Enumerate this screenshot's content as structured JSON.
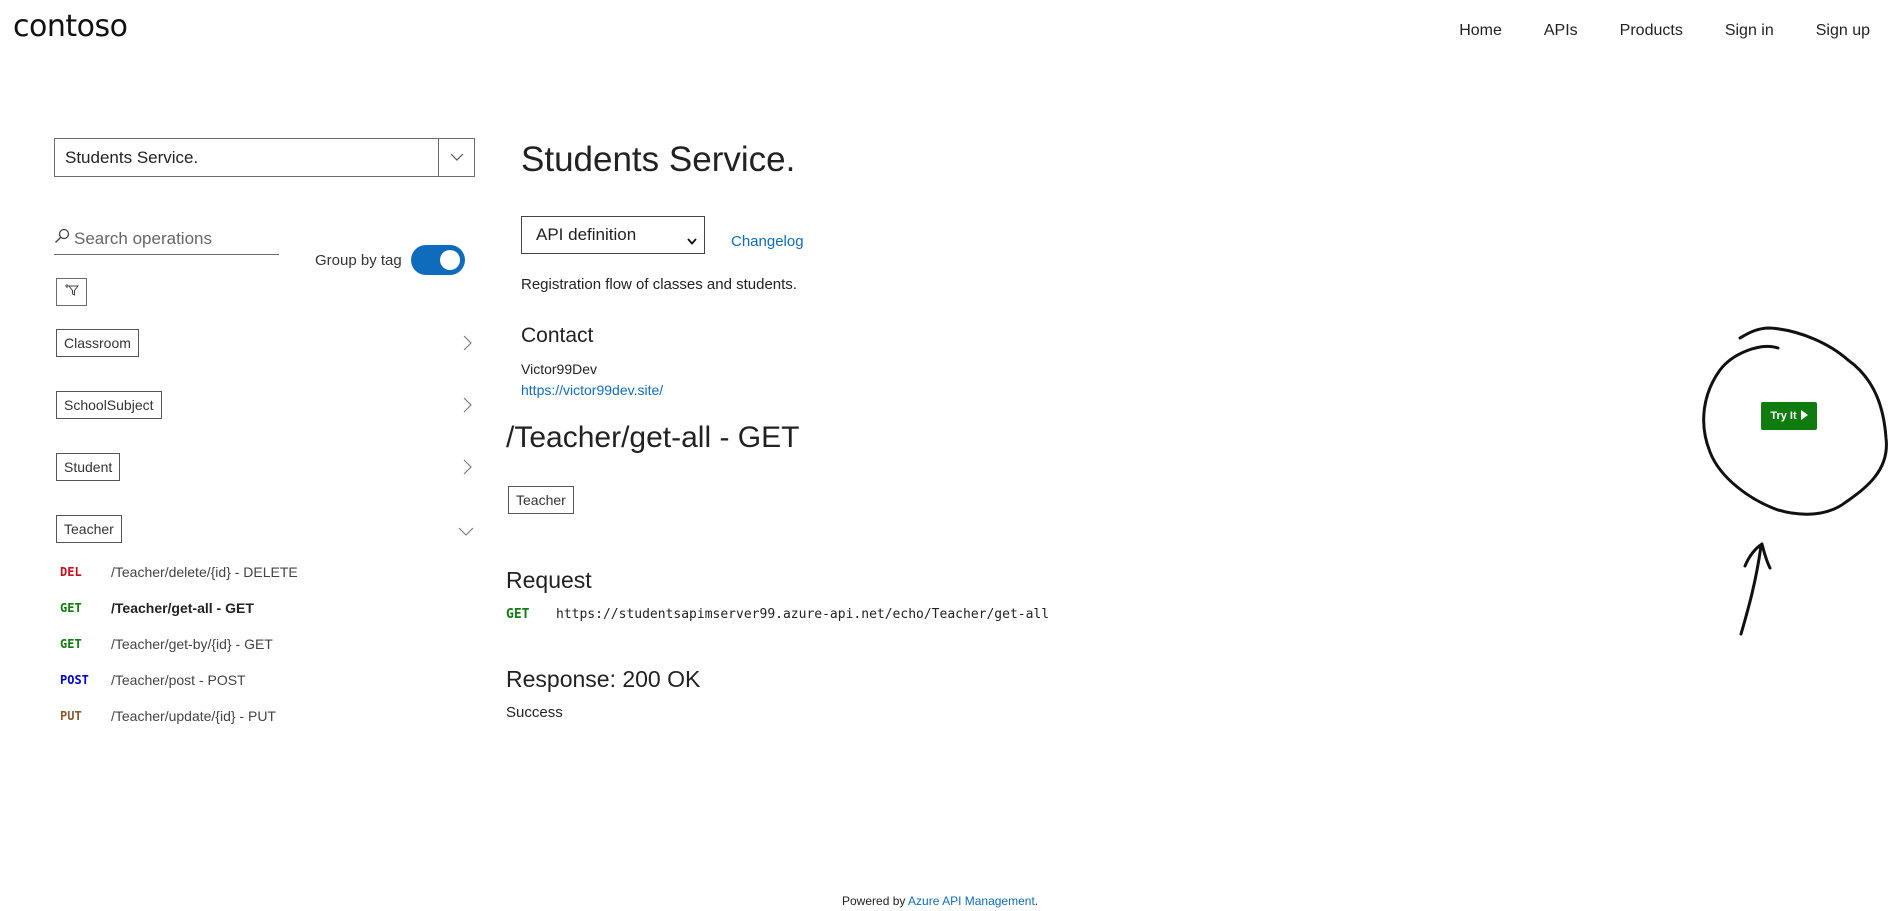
{
  "header": {
    "logo": "contoso",
    "nav": [
      "Home",
      "APIs",
      "Products",
      "Sign in",
      "Sign up"
    ]
  },
  "sidebar": {
    "api_selector_value": "Students Service.",
    "search_placeholder": "Search operations",
    "group_by_tag_label": "Group by tag",
    "group_by_tag_enabled": true,
    "tags": [
      "Classroom",
      "SchoolSubject",
      "Student",
      "Teacher"
    ],
    "operations": [
      {
        "method": "DEL",
        "label": "/Teacher/delete/{id} - DELETE"
      },
      {
        "method": "GET",
        "label": "/Teacher/get-all - GET"
      },
      {
        "method": "GET",
        "label": "/Teacher/get-by/{id} - GET"
      },
      {
        "method": "POST",
        "label": "/Teacher/post - POST"
      },
      {
        "method": "PUT",
        "label": "/Teacher/update/{id} - PUT"
      }
    ]
  },
  "main": {
    "title": "Students Service.",
    "definition_select": "API definition",
    "changelog": "Changelog",
    "description": "Registration flow of classes and students.",
    "contact_heading": "Contact",
    "contact_name": "Victor99Dev",
    "contact_url": "https://victor99dev.site/",
    "operation_title": "/Teacher/get-all - GET",
    "operation_tag": "Teacher",
    "request_heading": "Request",
    "request_method": "GET",
    "request_url": "https://studentsapimserver99.azure-api.net/echo/Teacher/get-all",
    "response_heading": "Response: 200 OK",
    "response_description": "Success",
    "try_it_label": "Try It"
  },
  "footer": {
    "prefix": "Powered by ",
    "link": "Azure API Management",
    "suffix": "."
  },
  "colors": {
    "accent": "#0f6cbd",
    "get": "#107c10",
    "delete": "#c50f1f",
    "post": "#0000cc",
    "put": "#8a5a2b",
    "try_it": "#107c10"
  }
}
